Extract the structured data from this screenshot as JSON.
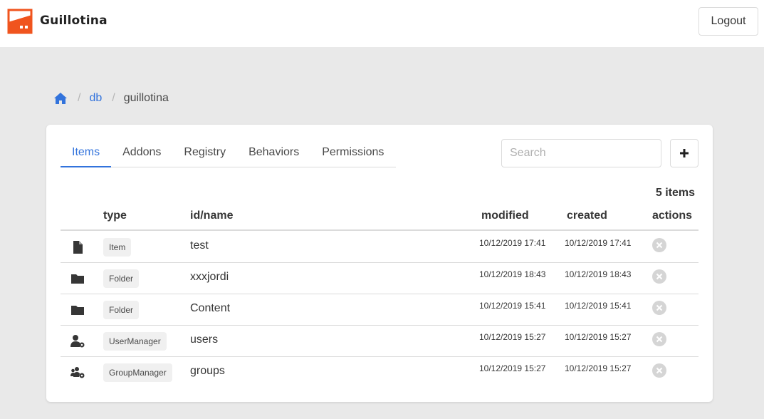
{
  "header": {
    "brand": "Guillotina",
    "logout_label": "Logout",
    "accent": "#f0541e"
  },
  "breadcrumb": {
    "home_icon": "home-icon",
    "items": [
      "db",
      "guillotina"
    ]
  },
  "tabs": [
    {
      "label": "Items",
      "active": true
    },
    {
      "label": "Addons",
      "active": false
    },
    {
      "label": "Registry",
      "active": false
    },
    {
      "label": "Behaviors",
      "active": false
    },
    {
      "label": "Permissions",
      "active": false
    }
  ],
  "search": {
    "placeholder": "Search",
    "value": ""
  },
  "add_icon": "plus-icon",
  "table": {
    "count_label": "5 items",
    "columns": [
      "type",
      "id/name",
      "modified",
      "created",
      "actions"
    ],
    "rows": [
      {
        "icon": "file-icon",
        "type": "Item",
        "name": "test",
        "modified": "10/12/2019 17:41",
        "created": "10/12/2019 17:41",
        "action_icon": "delete-icon"
      },
      {
        "icon": "folder-icon",
        "type": "Folder",
        "name": "xxxjordi",
        "modified": "10/12/2019 18:43",
        "created": "10/12/2019 18:43",
        "action_icon": "delete-icon"
      },
      {
        "icon": "folder-icon",
        "type": "Folder",
        "name": "Content",
        "modified": "10/12/2019 15:41",
        "created": "10/12/2019 15:41",
        "action_icon": "delete-icon"
      },
      {
        "icon": "user-cog-icon",
        "type": "UserManager",
        "name": "users",
        "modified": "10/12/2019 15:27",
        "created": "10/12/2019 15:27",
        "action_icon": "delete-icon"
      },
      {
        "icon": "users-cog-icon",
        "type": "GroupManager",
        "name": "groups",
        "modified": "10/12/2019 15:27",
        "created": "10/12/2019 15:27",
        "action_icon": "delete-icon"
      }
    ]
  },
  "colors": {
    "link": "#3273dc",
    "background": "#e9e9e9",
    "delete_icon": "#d5d5d5"
  }
}
